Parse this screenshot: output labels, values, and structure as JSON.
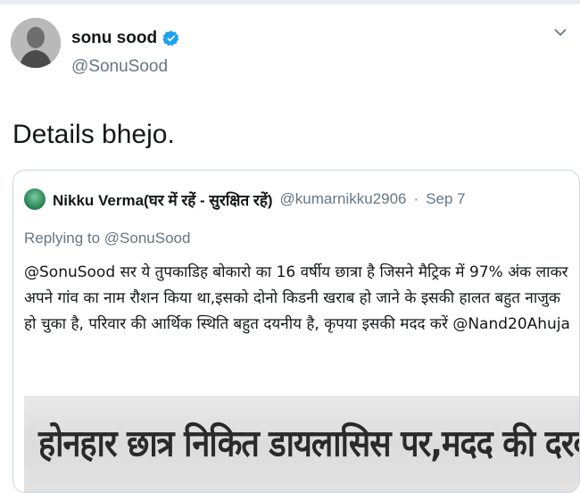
{
  "tweet": {
    "author": {
      "display_name": "sonu sood",
      "handle": "@SonuSood",
      "verified": true
    },
    "text": "Details bhejo.",
    "menu_icon": "chevron-down-icon"
  },
  "quoted_tweet": {
    "author_name": "Nikku Verma(घर में रहें - सुरक्षित रहें)",
    "author_handle": "@kumarnikku2906",
    "separator": "·",
    "date": "Sep 7",
    "replying_to": "Replying to @SonuSood",
    "body": "@SonuSood सर ये तुपकाडिह बोकारो का 16 वर्षीय छात्रा है जिसने मैट्रिक में 97% अंक लाकर अपने गांव का नाम रौशन किया था,इसको दोनो किडनी खराब हो जाने के इसकी हालत बहुत नाजुक हो चुका है, परिवार की आर्थिक स्थिति बहुत दयनीय है, कृपया इसकी मदद करें @Nand20Ahuja",
    "image_headline": "होनहार छात्र निकित डायलासिस पर,मदद की दरकार"
  },
  "colors": {
    "verified_badge": "#1da1f2",
    "secondary_text": "#657786",
    "border": "#ccd6dd"
  }
}
